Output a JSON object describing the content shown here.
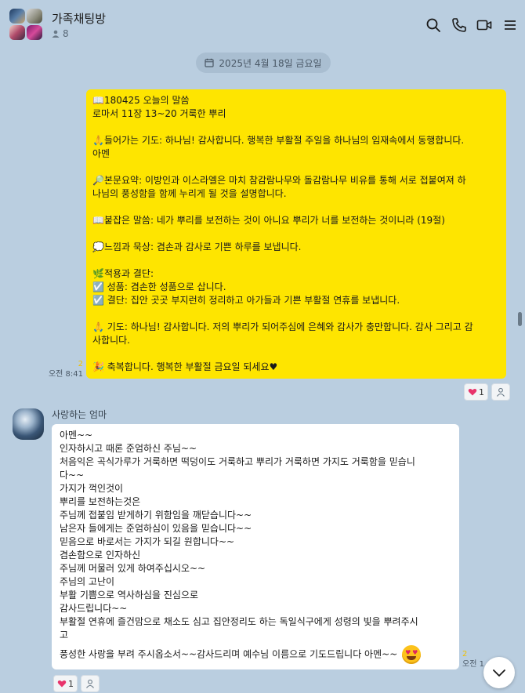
{
  "header": {
    "title": "가족채팅방",
    "member_count": "8",
    "icons": [
      "search-icon",
      "phone-icon",
      "video-call-icon",
      "menu-icon"
    ]
  },
  "date_divider": "2025년 4월 18일 금요일",
  "my_message": {
    "lines": [
      "📖180425 오늘의 말씀",
      "로마서 11장 13~20 거룩한 뿌리",
      "",
      "🙏들어가는 기도: 하나님! 감사합니다. 행복한 부활절 주일을 하나님의 임재속에서 동행합니다.",
      "아멘",
      "",
      "🔎본문요약: 이방인과 이스라엘은 마치 참감람나무와 돌감람나무 비유를 통해 서로 접붙여져 하",
      "나님의 풍성함을 함께 누리게 될 것을 설명합니다.",
      "",
      "📖붙잡은 말씀: 네가 뿌리를 보전하는 것이 아니요 뿌리가 너를 보전하는 것이니라 (19절)",
      "",
      "💭느낌과 묵상: 겸손과 감사로 기쁜 하루를 보냅니다.",
      "",
      "🌿적용과 결단:",
      "☑️ 성품: 겸손한 성품으로 삽니다.",
      "☑️ 결단: 집안 곳곳 부지런히 정리하고 아가들과 기쁜 부활절 연휴를 보냅니다.",
      "",
      "🙏 기도: 하나님! 감사합니다. 저의 뿌리가 되어주심에 은혜와 감사가 충만합니다. 감사 그리고 감",
      "사합니다.",
      "",
      "🎉 축복합니다. 행복한 부활절 금요일 되세요♥"
    ],
    "unread": "2",
    "time": "오전 8:41",
    "reaction_count": "1"
  },
  "mom_message": {
    "sender": "사랑하는 엄마",
    "lines": [
      "아멘~~",
      "인자하시고 때론 준엄하신 주님~~",
      "처음익은 곡식가루가 거룩하면 떡덩이도 거룩하고 뿌리가 거룩하면 가지도 거룩함을 믿습니",
      "다~~",
      "가지가 꺽인것이",
      "뿌리를 보전하는것은",
      "주님께 접붙임 받게하기 위함임을 깨닫습니다~~",
      "남은자 들에게는 준엄하심이 있음을 믿습니다~~",
      "믿음으로 바로서는 가지가 되길 원합니다~~",
      "겸손함으로 인자하신",
      "주님께 머물러 있게 하여주십시오~~",
      "주님의 고난이",
      "부활 기쁨으로 역사하심을 진심으로",
      "감사드립니다~~",
      "부활절 연휴에 즐건맘으로 채소도 심고 집안정리도 하는 독일식구에게 성령의 빛을 뿌려주시",
      "고",
      "풍성한 사랑을 부려 주시옵소서~~감사드리며 예수님 이름으로 기도드립니다 아멘~~"
    ],
    "unread": "2",
    "time": "오전 1",
    "reaction_count": "1"
  }
}
